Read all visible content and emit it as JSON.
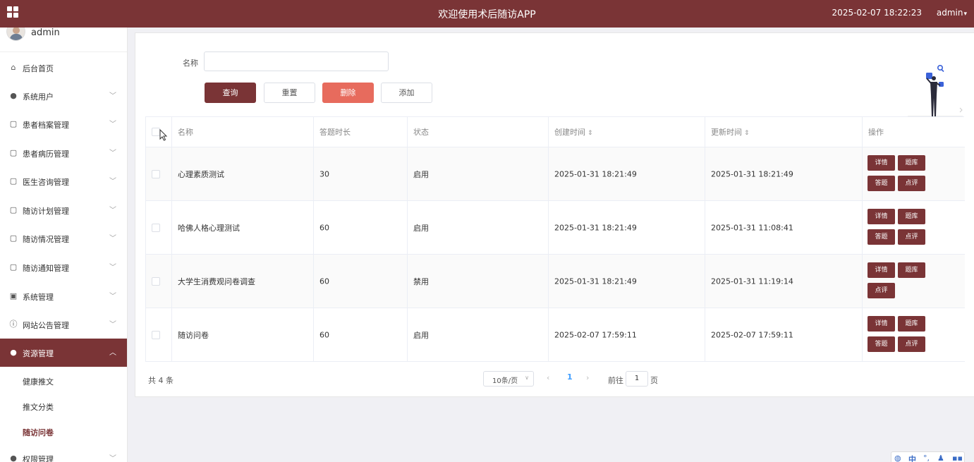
{
  "header": {
    "app_title": "欢迎使用术后随访APP",
    "datetime": "2025-02-07 18:22:23",
    "username": "admin"
  },
  "sidebar": {
    "user_name": "admin",
    "items": [
      {
        "label": "后台首页",
        "icon": "home-icon"
      },
      {
        "label": "系统用户",
        "icon": "user-icon"
      },
      {
        "label": "患者档案管理",
        "icon": "clipboard-icon"
      },
      {
        "label": "患者病历管理",
        "icon": "clipboard-icon"
      },
      {
        "label": "医生咨询管理",
        "icon": "clipboard-icon"
      },
      {
        "label": "随访计划管理",
        "icon": "clipboard-icon"
      },
      {
        "label": "随访情况管理",
        "icon": "clipboard-icon"
      },
      {
        "label": "随访通知管理",
        "icon": "clipboard-icon"
      },
      {
        "label": "系统管理",
        "icon": "picture-icon"
      },
      {
        "label": "网站公告管理",
        "icon": "info-icon"
      },
      {
        "label": "资源管理",
        "icon": "location-icon"
      },
      {
        "label": "权限管理",
        "icon": "user-icon"
      }
    ],
    "sub_items": [
      "健康推文",
      "推文分类",
      "随访问卷"
    ]
  },
  "search": {
    "label": "名称",
    "value": ""
  },
  "buttons": {
    "query": "查询",
    "reset": "重置",
    "delete": "删除",
    "add": "添加"
  },
  "table": {
    "columns": [
      "名称",
      "答题时长",
      "状态",
      "创建时间",
      "更新时间",
      "操作"
    ],
    "rows": [
      {
        "name": "心理素质测试",
        "duration": "30",
        "status": "启用",
        "created": "2025-01-31 18:21:49",
        "updated": "2025-01-31 18:21:49",
        "actions": [
          "详情",
          "题库",
          "答题",
          "点评"
        ]
      },
      {
        "name": "哈佛人格心理测试",
        "duration": "60",
        "status": "启用",
        "created": "2025-01-31 18:21:49",
        "updated": "2025-01-31 11:08:41",
        "actions": [
          "详情",
          "题库",
          "答题",
          "点评"
        ]
      },
      {
        "name": "大学生消费观问卷调查",
        "duration": "60",
        "status": "禁用",
        "created": "2025-01-31 18:21:49",
        "updated": "2025-01-31 11:19:14",
        "actions": [
          "详情",
          "题库",
          "点评"
        ]
      },
      {
        "name": "随访问卷",
        "duration": "60",
        "status": "启用",
        "created": "2025-02-07 17:59:11",
        "updated": "2025-02-07 17:59:11",
        "actions": [
          "详情",
          "题库",
          "答题",
          "点评"
        ]
      }
    ]
  },
  "pagination": {
    "total": "共 4 条",
    "page_size": "10条/页",
    "current_page": "1",
    "goto_label": "前往",
    "goto_value": "1",
    "page_suffix": "页"
  },
  "ime": {
    "mode": "中"
  },
  "colors": {
    "brand": "#7a3436",
    "danger": "#e76b5d",
    "link": "#409eff"
  }
}
